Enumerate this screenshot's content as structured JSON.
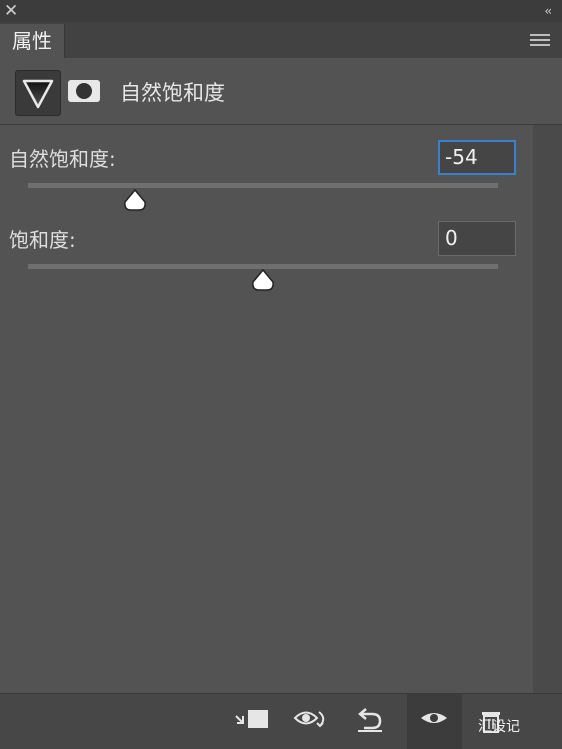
{
  "panel": {
    "close_icon": "close-icon",
    "collapse_icon": "double-chevron-left-icon",
    "tab_label": "属性",
    "menu_icon": "hamburger-menu-icon"
  },
  "header": {
    "adjustment_icon": "vibrance-icon",
    "mask_icon": "mask-icon",
    "title": "自然饱和度"
  },
  "sliders": [
    {
      "label": "自然饱和度:",
      "value": "-54",
      "fraction": 0.227,
      "focused": true
    },
    {
      "label": "饱和度:",
      "value": "0",
      "fraction": 0.5,
      "focused": false
    }
  ],
  "footer": {
    "buttons": [
      "clip-to-layer-icon",
      "view-previous-state-icon",
      "reset-icon",
      "visibility-icon",
      "delete-icon"
    ],
    "watermark": "汇设记"
  }
}
